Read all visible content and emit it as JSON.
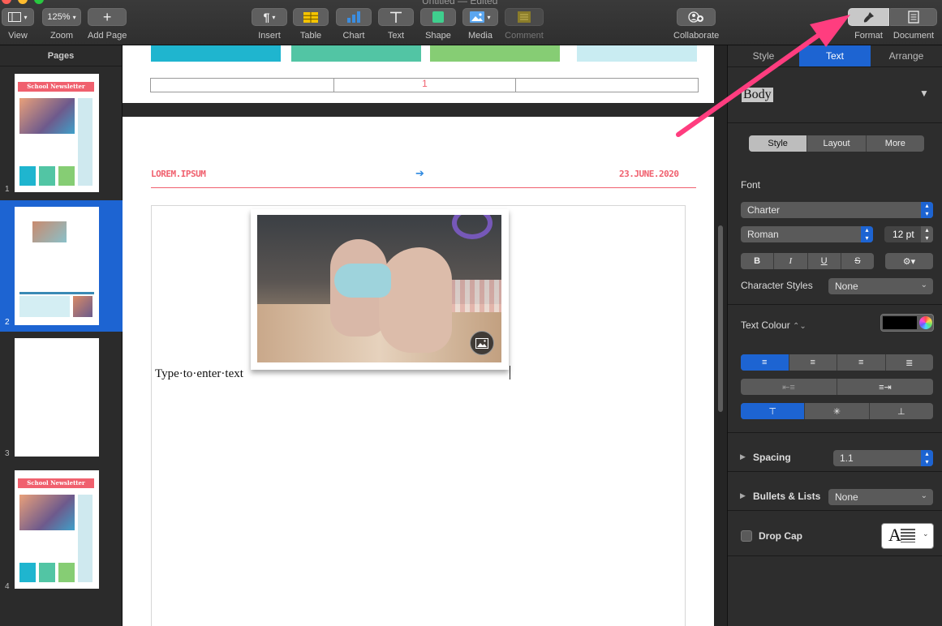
{
  "window": {
    "title_fragment": "Untitled — Edited"
  },
  "toolbar": {
    "view_label": "View",
    "zoom_value": "125%",
    "zoom_label": "Zoom",
    "add_page_label": "Add Page",
    "insert_label": "Insert",
    "table_label": "Table",
    "chart_label": "Chart",
    "text_label": "Text",
    "shape_label": "Shape",
    "media_label": "Media",
    "comment_label": "Comment",
    "collaborate_label": "Collaborate",
    "format_label": "Format",
    "document_label": "Document"
  },
  "sidebar": {
    "title": "Pages",
    "pages": [
      {
        "number": "1",
        "newsletter_title": "School Newsletter"
      },
      {
        "number": "2"
      },
      {
        "number": "3"
      },
      {
        "number": "4",
        "newsletter_title": "School Newsletter"
      }
    ]
  },
  "document": {
    "table_cell_text": "1",
    "header_left": "LOREM.IPSUM",
    "header_right": "23.JUNE.2020",
    "placeholder_text": "Type·to·enter·text"
  },
  "inspector": {
    "tabs": [
      "Style",
      "Text",
      "Arrange"
    ],
    "active_tab": "Text",
    "paragraph_style": "Body",
    "subtabs": [
      "Style",
      "Layout",
      "More"
    ],
    "font_section_label": "Font",
    "font_family": "Charter",
    "font_typeface": "Roman",
    "font_size": "12 pt",
    "bold_label": "B",
    "italic_label": "I",
    "underline_label": "U",
    "strike_label": "S",
    "character_styles_label": "Character Styles",
    "character_styles_value": "None",
    "text_colour_label": "Text Colour",
    "spacing_label": "Spacing",
    "spacing_value": "1.1",
    "bullets_label": "Bullets & Lists",
    "bullets_value": "None",
    "drop_cap_label": "Drop Cap",
    "drop_cap_preview": "A"
  },
  "colors": {
    "accent_blue": "#1d64d2",
    "newsletter_pink": "#f0606e",
    "arrow_pink": "#ff3d7f",
    "swatch_teal": "#1fb5cf",
    "swatch_green": "#52c5a4",
    "swatch_lime": "#86cd74",
    "swatch_lightblue": "#c9ecf2"
  }
}
